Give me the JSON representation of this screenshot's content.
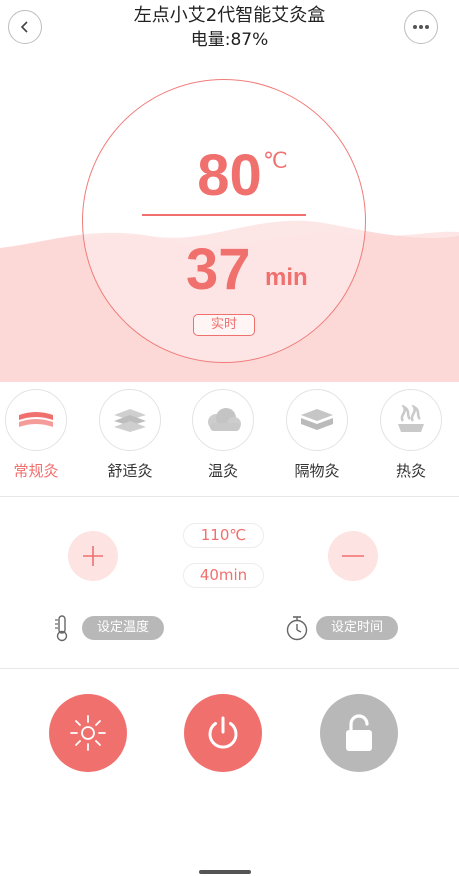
{
  "header": {
    "title": "左点小艾2代智能艾灸盒",
    "battery": "电量:87%"
  },
  "dial": {
    "temperature": "80",
    "temperature_unit": "℃",
    "duration": "37",
    "duration_unit": "min",
    "badge": "实时"
  },
  "modes": [
    {
      "label": "常规灸",
      "icon": "regular-moxibustion-icon",
      "active": true
    },
    {
      "label": "舒适灸",
      "icon": "comfort-moxibustion-icon",
      "active": false
    },
    {
      "label": "温灸",
      "icon": "warm-moxibustion-icon",
      "active": false
    },
    {
      "label": "隔物灸",
      "icon": "indirect-moxibustion-icon",
      "active": false
    },
    {
      "label": "热灸",
      "icon": "hot-moxibustion-icon",
      "active": false
    }
  ],
  "settings": {
    "temperature_value": "110℃",
    "time_value": "40min",
    "set_temperature_label": "设定温度",
    "set_time_label": "设定时间"
  },
  "colors": {
    "accent": "#f0706e",
    "wave": "#fcd6d5",
    "locked": "#b8b8b8"
  }
}
